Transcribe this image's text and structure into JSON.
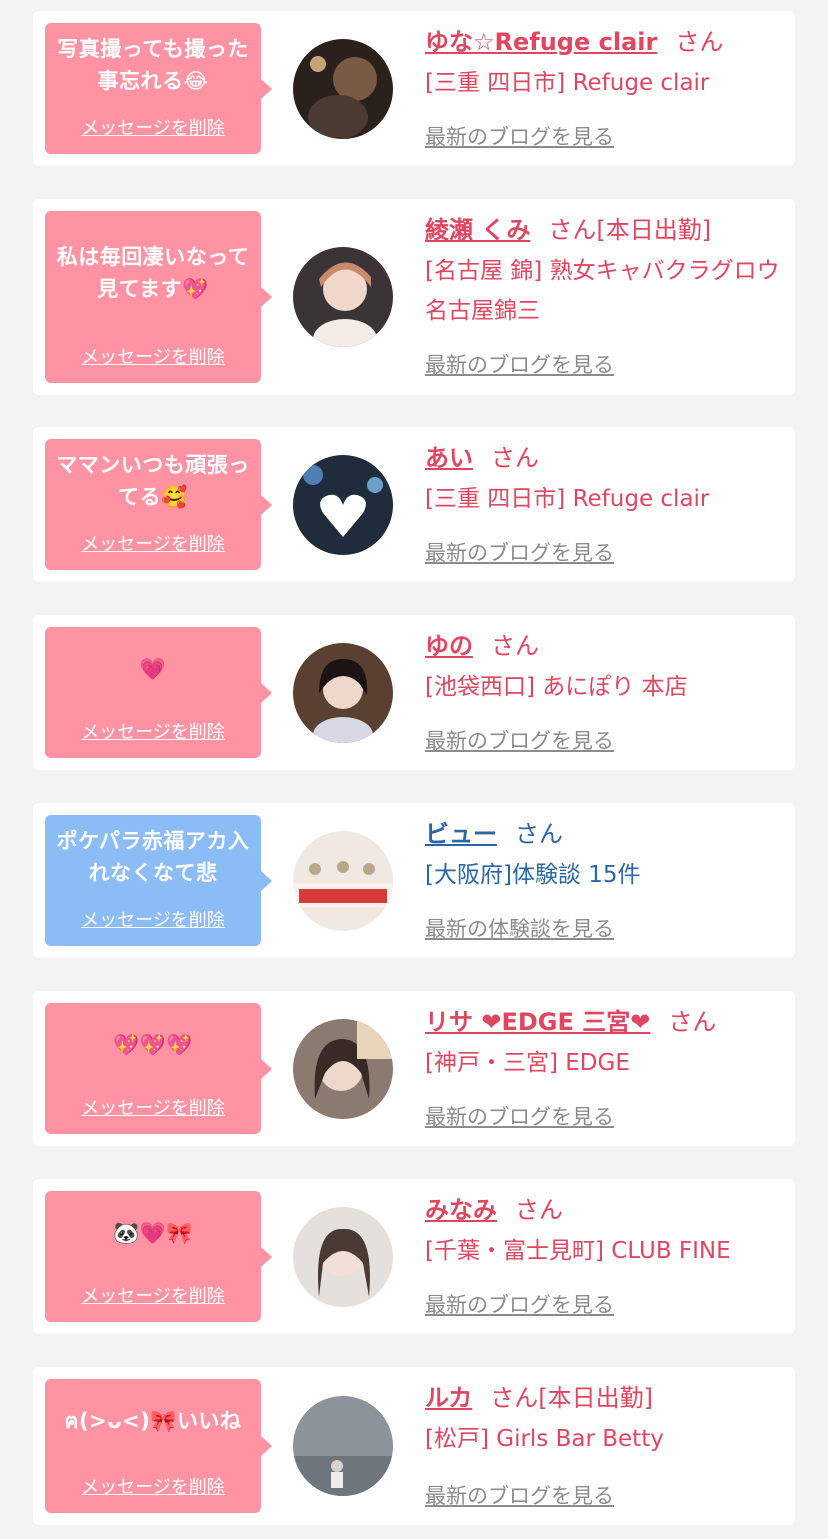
{
  "delete_label": "メッセージを削除",
  "san_label": "さん",
  "colors": {
    "pink_bubble": "#ff93a4",
    "blue_bubble": "#8cbcf5",
    "name_pink": "#e0465f",
    "name_blue": "#2b66a6",
    "link_gray": "#8c8c8c"
  },
  "items": [
    {
      "message": "写真撮っても撮った事忘れる😂",
      "name": "ゆな☆Refuge clair",
      "badge": "",
      "shop": "[三重 四日市] Refuge clair",
      "link": "最新のブログを見る"
    },
    {
      "message": "私は毎回凄いなって見てます💖",
      "name": "綾瀬 くみ",
      "badge": "[本日出勤]",
      "shop": "[名古屋 錦] 熟女キャバクラグロウ 名古屋錦三",
      "link": "最新のブログを見る"
    },
    {
      "message": "ママンいつも頑張ってる🥰",
      "name": "あい",
      "badge": "",
      "shop": "[三重 四日市] Refuge clair",
      "link": "最新のブログを見る"
    },
    {
      "message": "💗",
      "name": "ゆの",
      "badge": "",
      "shop": "[池袋西口] あにぽり 本店",
      "link": "最新のブログを見る"
    },
    {
      "message": "ポケパラ赤福アカ入れなくなて悲",
      "name": "ビュー",
      "badge": "",
      "shop": "[大阪府]体験談 15件",
      "link": "最新の体験談を見る"
    },
    {
      "message": "💖💖💖",
      "name": "リサ ❤EDGE 三宮❤",
      "badge": "",
      "shop": "[神戸・三宮] EDGE",
      "link": "最新のブログを見る"
    },
    {
      "message": "🐼💗🎀",
      "name": "みなみ",
      "badge": "",
      "shop": "[千葉・富士見町] CLUB FINE",
      "link": "最新のブログを見る"
    },
    {
      "message": "ฅ(>ᴗ<)🎀いいね",
      "name": "ルカ",
      "badge": "[本日出勤]",
      "shop": "[松戸] Girls Bar Betty",
      "link": "最新のブログを見る"
    }
  ]
}
